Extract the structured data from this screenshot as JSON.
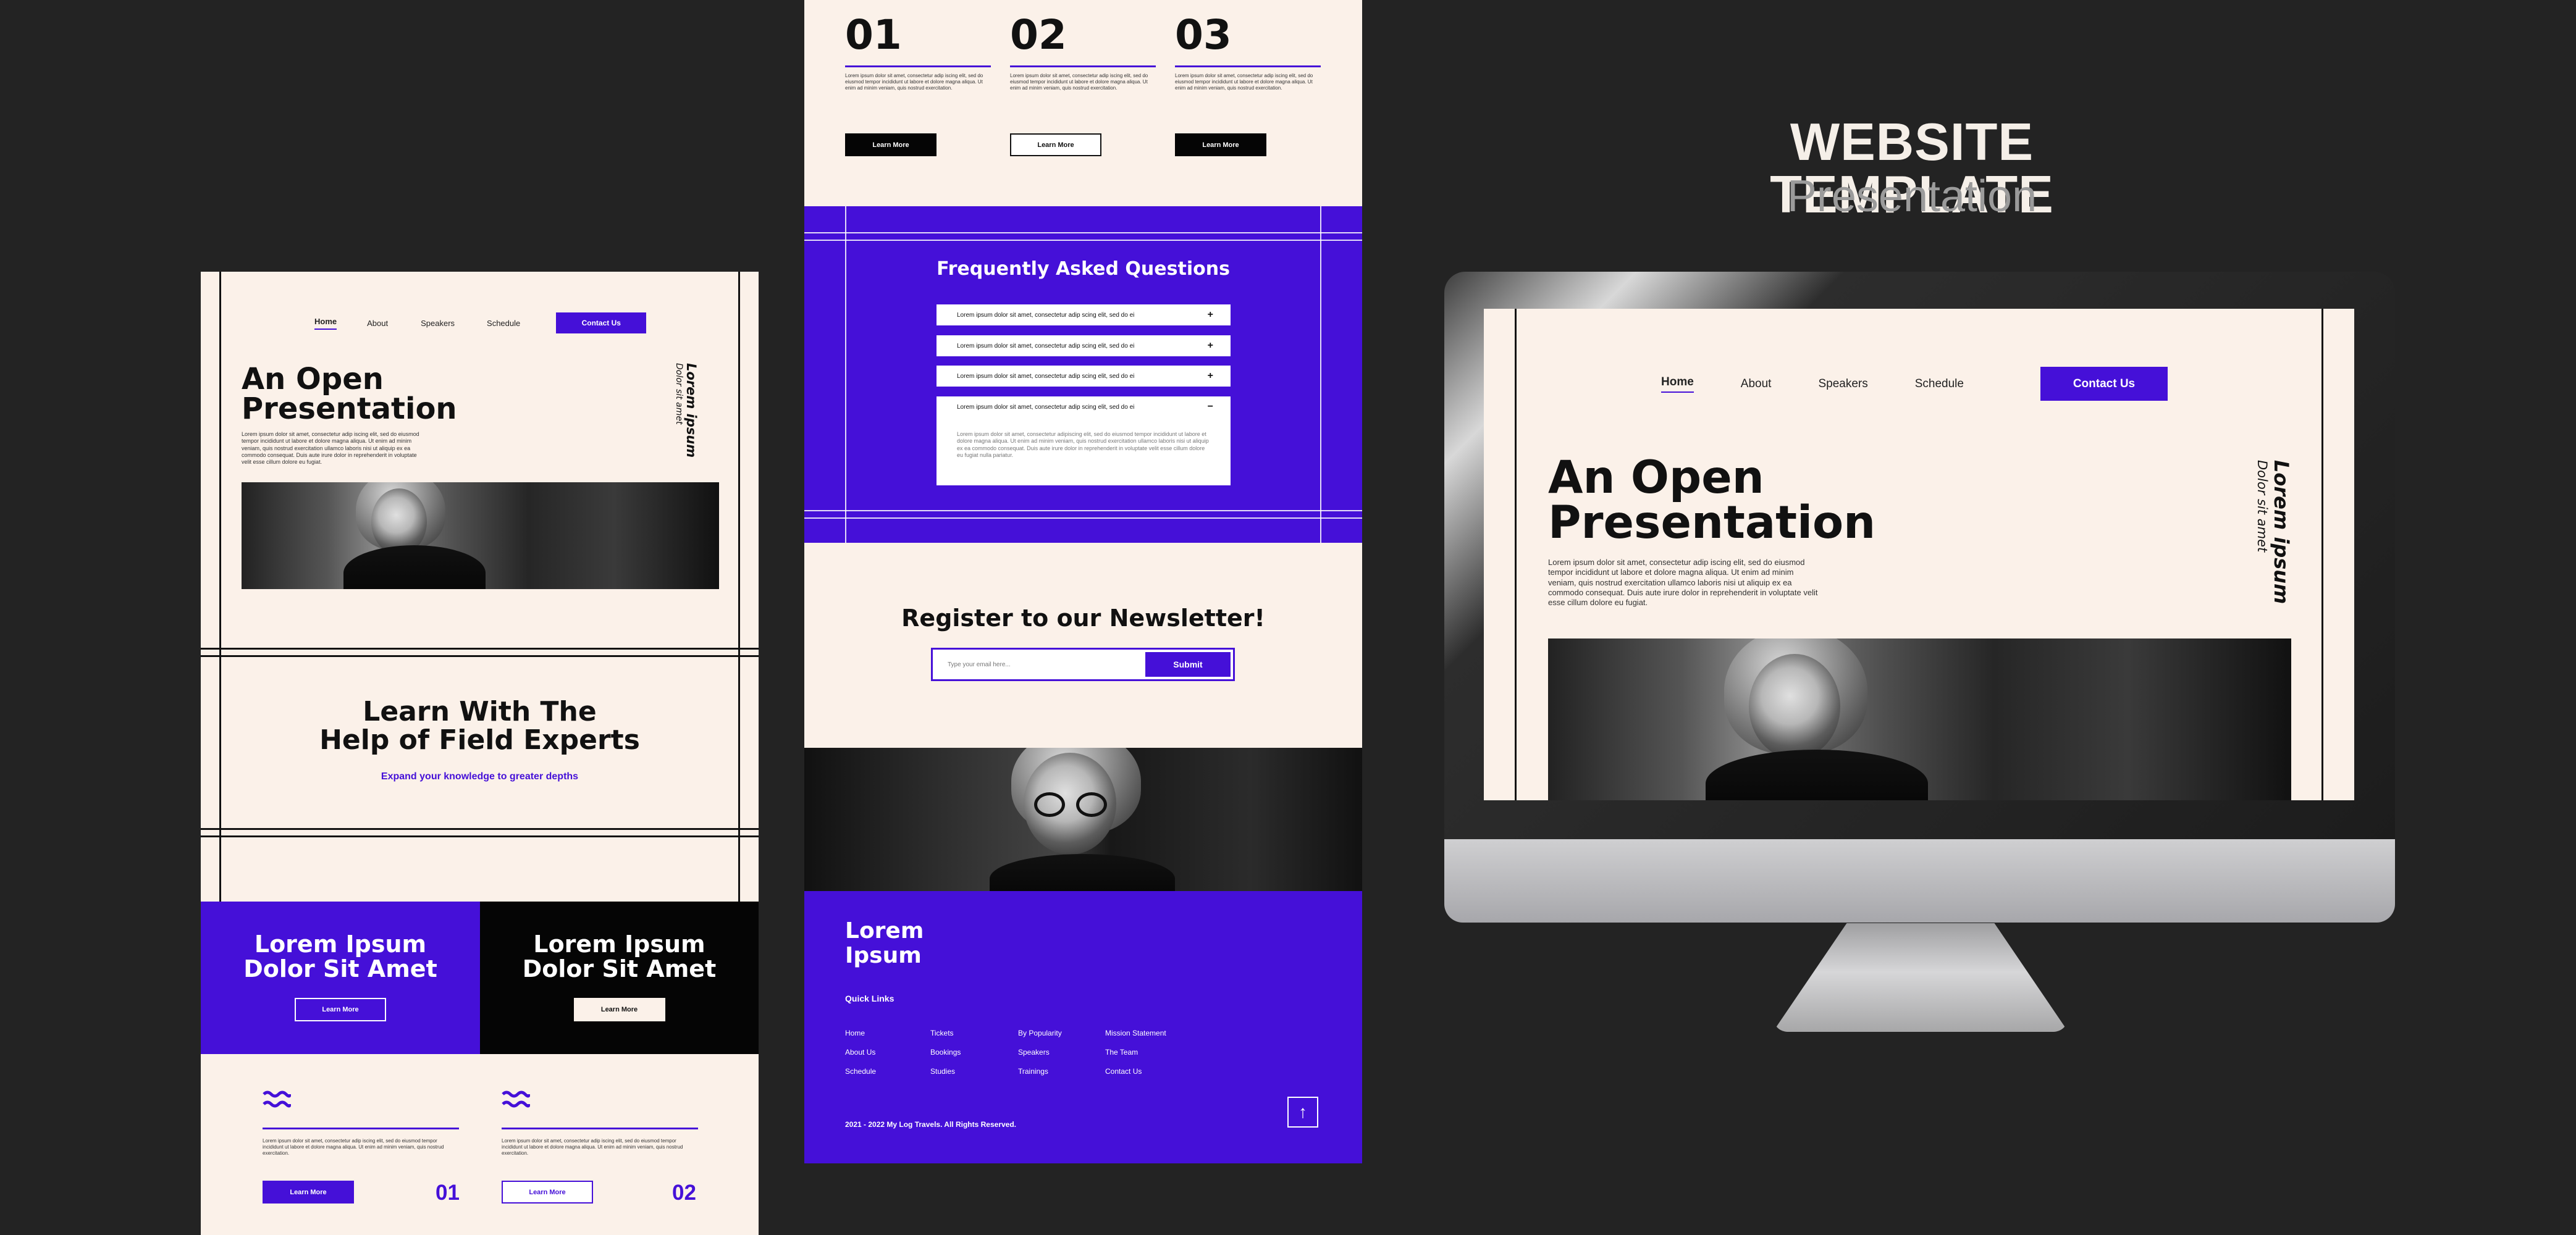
{
  "header": {
    "title": "WEBSITE TEMPLATE",
    "subtitle": "Presentation"
  },
  "nav": {
    "home": "Home",
    "about": "About",
    "speakers": "Speakers",
    "schedule": "Schedule",
    "contact": "Contact Us"
  },
  "hero": {
    "line1": "An Open",
    "line2": "Presentation",
    "vertical_1": "Lorem ipsum",
    "vertical_2": "Dolor sit amet",
    "text": "Lorem ipsum dolor sit amet, consectetur adip iscing elit, sed do eiusmod tempor incididunt ut labore et dolore magna aliqua. Ut enim ad minim veniam, quis nostrud exercitation ullamco laboris nisi ut aliquip ex ea commodo consequat. Duis aute irure dolor in reprehenderit in voluptate velit esse cillum dolore eu fugiat."
  },
  "learn": {
    "line1": "Learn With The",
    "line2": "Help of Field Experts",
    "subtitle": "Expand your knowledge to greater depths"
  },
  "lorem_cards": [
    {
      "line1": "Lorem Ipsum",
      "line2": "Dolor Sit Amet",
      "button": "Learn More"
    },
    {
      "line1": "Lorem Ipsum",
      "line2": "Dolor Sit Amet",
      "button": "Learn More"
    }
  ],
  "features": [
    {
      "num": "01",
      "button": "Learn More",
      "text": "Lorem ipsum dolor sit amet, consectetur adip iscing elit, sed do eiusmod tempor incididunt ut labore et dolore magna aliqua. Ut enim ad minim veniam, quis nostrud exercitation."
    },
    {
      "num": "02",
      "button": "Learn More",
      "text": "Lorem ipsum dolor sit amet, consectetur adip iscing elit, sed do eiusmod tempor incididunt ut labore et dolore magna aliqua. Ut enim ad minim veniam, quis nostrud exercitation."
    },
    {
      "num": "03",
      "button": "Learn More",
      "text": "Lorem ipsum dolor sit amet, consectetur adip iscing elit, sed do eiusmod tempor incididunt ut labore et dolore magna aliqua. Ut enim ad minim veniam, quis nostrud exercitation."
    }
  ],
  "faq": {
    "title": "Frequently Asked Questions",
    "items": [
      "Lorem ipsum dolor sit amet, consectetur adip scing elit, sed do ei",
      "Lorem ipsum dolor sit amet, consectetur adip scing elit, sed do ei",
      "Lorem ipsum dolor sit amet, consectetur adip scing elit, sed do ei",
      "Lorem ipsum dolor sit amet, consectetur adip scing elit, sed do ei"
    ],
    "answer": "Lorem ipsum dolor sit amet, consectetur adipiscing elit, sed do eiusmod tempor incididunt ut labore et dolore magna aliqua. Ut enim ad minim veniam, quis nostrud exercitation ullamco laboris nisi ut aliquip ex ea commodo consequat. Duis aute irure dolor in reprehenderit in voluptate velit esse cillum dolore eu fugiat nulla pariatur."
  },
  "newsletter": {
    "title": "Register to our Newsletter!",
    "placeholder": "Type your email here...",
    "button": "Submit"
  },
  "footer": {
    "brand_1": "Lorem",
    "brand_2": "Ipsum",
    "quick_links": "Quick Links",
    "cols": [
      [
        "Home",
        "About Us",
        "Schedule"
      ],
      [
        "Tickets",
        "Bookings",
        "Studies"
      ],
      [
        "By Popularity",
        "Speakers",
        "Trainings"
      ],
      [
        "Mission Statement",
        "The Team",
        "Contact Us"
      ]
    ],
    "copyright": "2021 - 2022 My Log Travels. All Rights Reserved."
  },
  "colors": {
    "accent": "#4510d8",
    "cream": "#fbf1e9",
    "dark_bg": "#232323",
    "black": "#050505"
  },
  "icons": {
    "wave": "wave-icon",
    "plus": "plus-icon",
    "minus": "minus-icon",
    "up_arrow": "arrow-up-icon"
  }
}
